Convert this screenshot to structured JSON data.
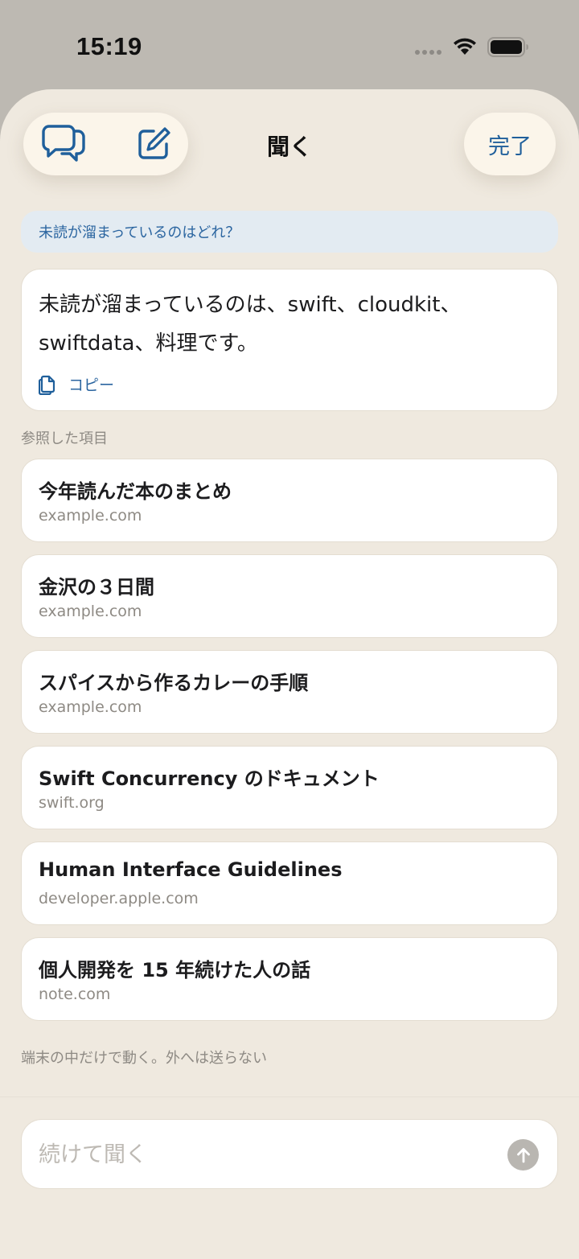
{
  "status_bar": {
    "time": "15:19"
  },
  "header": {
    "title": "聞く",
    "done_label": "完了"
  },
  "query": {
    "text": "未読が溜まっているのはどれ？"
  },
  "answer": {
    "text": "未読が溜まっているのは、swift、cloudkit、swiftdata、料理です。",
    "copy_label": "コピー"
  },
  "references": {
    "label": "参照した項目",
    "items": [
      {
        "title": "今年読んだ本のまとめ",
        "domain": "example.com"
      },
      {
        "title": "金沢の３日間",
        "domain": "example.com"
      },
      {
        "title": "スパイスから作るカレーの手順",
        "domain": "example.com"
      },
      {
        "title": "Swift Concurrency のドキュメント",
        "domain": "swift.org"
      },
      {
        "title": "Human Interface Guidelines",
        "domain": "developer.apple.com"
      },
      {
        "title": "個人開発を 15 年続けた人の話",
        "domain": "note.com"
      }
    ]
  },
  "privacy_note": "端末の中だけで動く。外へは送らない",
  "composer": {
    "placeholder": "続けて聞く",
    "value": ""
  },
  "colors": {
    "accent": "#1f5f9b",
    "sheet_background": "#efe9df",
    "query_bubble": "#e3ebf2",
    "send_disabled": "#b9b6b1"
  },
  "icons": {
    "chats": "chat-bubbles-icon",
    "compose": "compose-icon",
    "copy": "copy-icon",
    "send": "arrow-up-icon"
  }
}
